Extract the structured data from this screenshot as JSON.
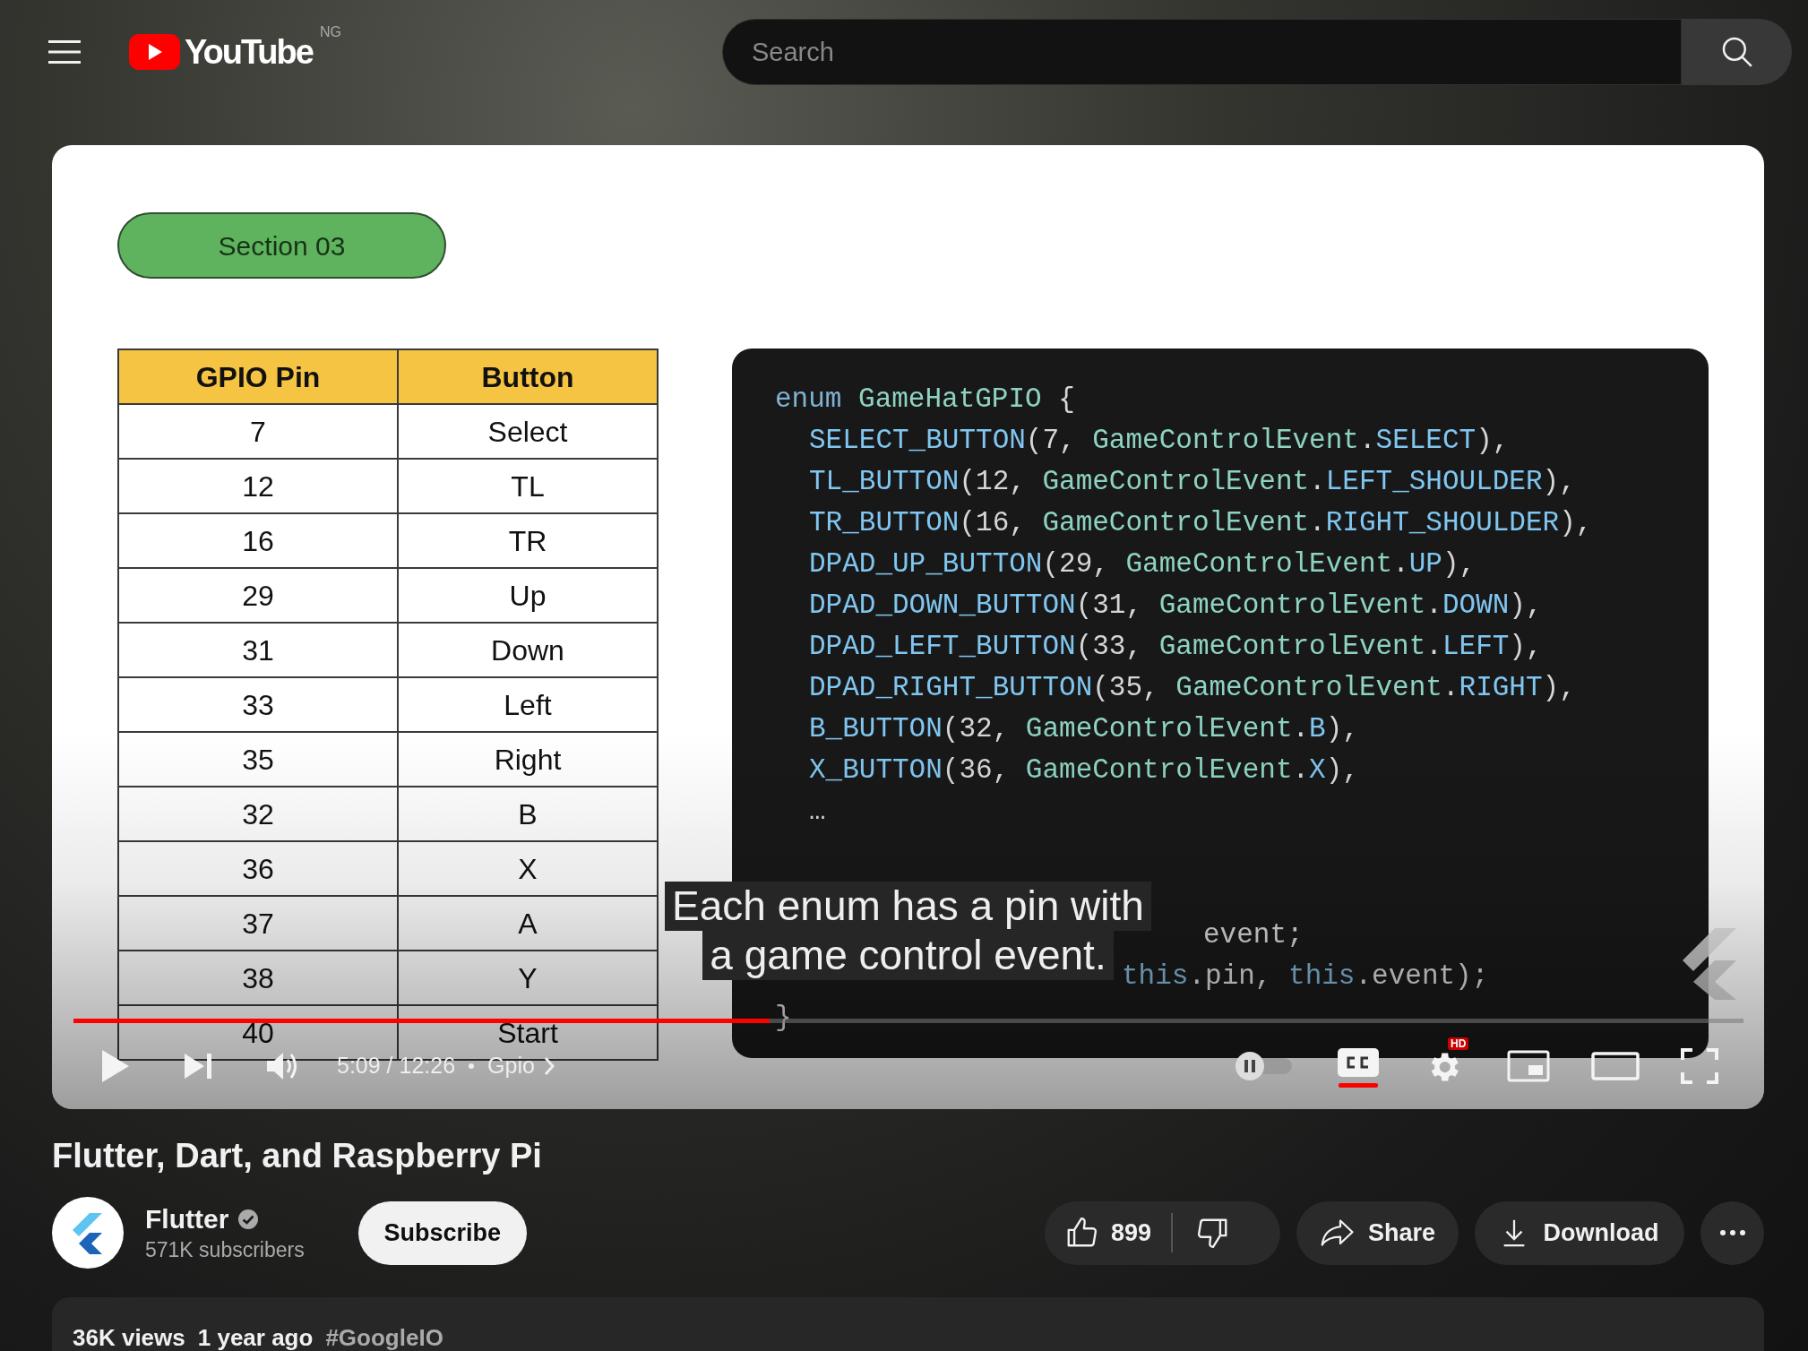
{
  "header": {
    "logo_text": "YouTube",
    "country_code": "NG",
    "search": {
      "placeholder": "Search"
    }
  },
  "player": {
    "slide": {
      "section_label": "Section 03",
      "table": {
        "columns": [
          "GPIO Pin",
          "Button"
        ],
        "rows": [
          [
            "7",
            "Select"
          ],
          [
            "12",
            "TL"
          ],
          [
            "16",
            "TR"
          ],
          [
            "29",
            "Up"
          ],
          [
            "31",
            "Down"
          ],
          [
            "33",
            "Left"
          ],
          [
            "35",
            "Right"
          ],
          [
            "32",
            "B"
          ],
          [
            "36",
            "X"
          ],
          [
            "37",
            "A"
          ],
          [
            "38",
            "Y"
          ],
          [
            "40",
            "Start"
          ]
        ]
      },
      "code": [
        {
          "kind": "code",
          "tokens": [
            {
              "text": "enum",
              "kind": "keyword"
            },
            {
              "text": " GameHatGPIO",
              "kind": "type"
            },
            {
              "text": " {",
              "kind": "plain"
            }
          ],
          "children": [
            {
              "kind": "code",
              "tokens": [
                {
                  "text": "SELECT_BUTTON",
                  "kind": "member"
                },
                {
                  "text": "(7, ",
                  "kind": "plain"
                },
                {
                  "text": "GameControlEvent",
                  "kind": "type"
                },
                {
                  "text": ".",
                  "kind": "plain"
                },
                {
                  "text": "SELECT",
                  "kind": "member"
                },
                {
                  "text": "),",
                  "kind": "plain"
                }
              ]
            },
            {
              "kind": "code",
              "tokens": [
                {
                  "text": "TL_BUTTON",
                  "kind": "member"
                },
                {
                  "text": "(12, ",
                  "kind": "plain"
                },
                {
                  "text": "GameControlEvent",
                  "kind": "type"
                },
                {
                  "text": ".",
                  "kind": "plain"
                },
                {
                  "text": "LEFT_SHOULDER",
                  "kind": "member"
                },
                {
                  "text": "),",
                  "kind": "plain"
                }
              ]
            },
            {
              "kind": "code",
              "tokens": [
                {
                  "text": "TR_BUTTON",
                  "kind": "member"
                },
                {
                  "text": "(16, ",
                  "kind": "plain"
                },
                {
                  "text": "GameControlEvent",
                  "kind": "type"
                },
                {
                  "text": ".",
                  "kind": "plain"
                },
                {
                  "text": "RIGHT_SHOULDER",
                  "kind": "member"
                },
                {
                  "text": "),",
                  "kind": "plain"
                }
              ]
            },
            {
              "kind": "code",
              "tokens": [
                {
                  "text": "DPAD_UP_BUTTON",
                  "kind": "member"
                },
                {
                  "text": "(29, ",
                  "kind": "plain"
                },
                {
                  "text": "GameControlEvent",
                  "kind": "type"
                },
                {
                  "text": ".",
                  "kind": "plain"
                },
                {
                  "text": "UP",
                  "kind": "member"
                },
                {
                  "text": "),",
                  "kind": "plain"
                }
              ]
            },
            {
              "kind": "code",
              "tokens": [
                {
                  "text": "DPAD_DOWN_BUTTON",
                  "kind": "member"
                },
                {
                  "text": "(31, ",
                  "kind": "plain"
                },
                {
                  "text": "GameControlEvent",
                  "kind": "type"
                },
                {
                  "text": ".",
                  "kind": "plain"
                },
                {
                  "text": "DOWN",
                  "kind": "member"
                },
                {
                  "text": "),",
                  "kind": "plain"
                }
              ]
            },
            {
              "kind": "code",
              "tokens": [
                {
                  "text": "DPAD_LEFT_BUTTON",
                  "kind": "member"
                },
                {
                  "text": "(33, ",
                  "kind": "plain"
                },
                {
                  "text": "GameControlEvent",
                  "kind": "type"
                },
                {
                  "text": ".",
                  "kind": "plain"
                },
                {
                  "text": "LEFT",
                  "kind": "member"
                },
                {
                  "text": "),",
                  "kind": "plain"
                }
              ]
            },
            {
              "kind": "code",
              "tokens": [
                {
                  "text": "DPAD_RIGHT_BUTTON",
                  "kind": "member"
                },
                {
                  "text": "(35, ",
                  "kind": "plain"
                },
                {
                  "text": "GameControlEvent",
                  "kind": "type"
                },
                {
                  "text": ".",
                  "kind": "plain"
                },
                {
                  "text": "RIGHT",
                  "kind": "member"
                },
                {
                  "text": "),",
                  "kind": "plain"
                }
              ]
            },
            {
              "kind": "code",
              "tokens": [
                {
                  "text": "B_BUTTON",
                  "kind": "member"
                },
                {
                  "text": "(32, ",
                  "kind": "plain"
                },
                {
                  "text": "GameControlEvent",
                  "kind": "type"
                },
                {
                  "text": ".",
                  "kind": "plain"
                },
                {
                  "text": "B",
                  "kind": "member"
                },
                {
                  "text": "),",
                  "kind": "plain"
                }
              ]
            },
            {
              "kind": "code",
              "tokens": [
                {
                  "text": "X_BUTTON",
                  "kind": "member"
                },
                {
                  "text": "(36, ",
                  "kind": "plain"
                },
                {
                  "text": "GameControlEvent",
                  "kind": "type"
                },
                {
                  "text": ".",
                  "kind": "plain"
                },
                {
                  "text": "X",
                  "kind": "member"
                },
                {
                  "text": "),",
                  "kind": "plain"
                }
              ]
            },
            {
              "kind": "code",
              "tokens": [
                {
                  "text": "…",
                  "kind": "plain"
                }
              ]
            },
            {
              "kind": "blank"
            },
            {
              "kind": "blank"
            },
            {
              "kind": "tail",
              "tokens": [
                {
                  "text": "event;",
                  "kind": "plain"
                }
              ]
            },
            {
              "kind": "tail",
              "tokens": [
                {
                  "text": "this",
                  "kind": "keyword"
                },
                {
                  "text": ".pin, ",
                  "kind": "plain"
                },
                {
                  "text": "this",
                  "kind": "keyword"
                },
                {
                  "text": ".event);",
                  "kind": "plain"
                }
              ]
            }
          ]
        },
        {
          "kind": "code",
          "tokens": [
            {
              "text": "}",
              "kind": "plain"
            }
          ]
        }
      ]
    },
    "caption": [
      "Each enum has a pin with",
      "a game control event."
    ],
    "progress": {
      "level": 0.417
    },
    "time": "5:09 / 12:26",
    "chapter": "Gpio",
    "autoplay": {
      "on": false
    },
    "captions": {
      "on": true
    },
    "settings_badge": "HD"
  },
  "title": "Flutter, Dart, and Raspberry Pi",
  "channel": {
    "name": "Flutter",
    "verified": true,
    "subscribers": "571K subscribers"
  },
  "actions": {
    "subscribe": "Subscribe",
    "likes": "899",
    "share": "Share",
    "download": "Download"
  },
  "description": {
    "views": "36K views",
    "age": "1 year ago",
    "hashtag": "#GoogleIO"
  }
}
